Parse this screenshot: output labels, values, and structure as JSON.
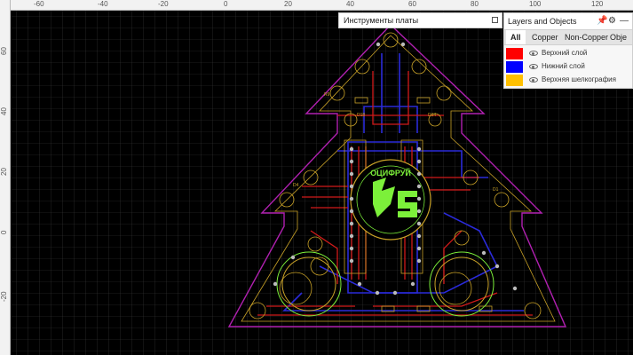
{
  "ruler": {
    "top_labels": [
      "-60",
      "-40",
      "-20",
      "0",
      "20",
      "40",
      "60",
      "80",
      "100",
      "120"
    ],
    "left_labels": [
      "60",
      "40",
      "20",
      "0",
      "-20"
    ]
  },
  "board": {
    "logo_text": "ОЦИФРУЙ",
    "designators": [
      "D18",
      "D14",
      "R9",
      "D1",
      "D4"
    ]
  },
  "tools_panel": {
    "title": "Инструменты платы"
  },
  "layers_panel": {
    "title": "Layers and Objects",
    "tabs": [
      "All",
      "Copper",
      "Non-Copper",
      "Obje"
    ],
    "active_tab": "All",
    "layers": [
      {
        "name": "Верхний слой",
        "color": "#ff0000"
      },
      {
        "name": "Нижний слой",
        "color": "#0000ff"
      },
      {
        "name": "Верхняя шелкография",
        "color": "#ffc000"
      }
    ],
    "icons": [
      "pin-icon",
      "gear-icon",
      "minimize-icon"
    ]
  },
  "colors": {
    "top_copper": "#d11a1a",
    "bottom_copper": "#2a2ad8",
    "silk": "#c9a227",
    "outline": "#b020b0",
    "pad": "#bbbbbb",
    "logo": "#7cf03a"
  }
}
